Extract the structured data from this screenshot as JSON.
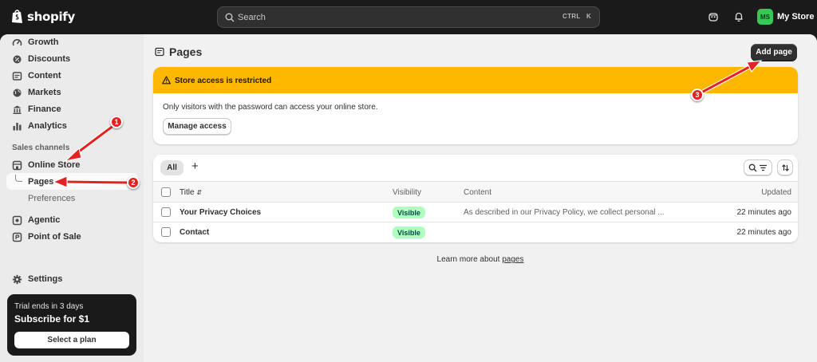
{
  "topbar": {
    "logo": "shopify",
    "search_placeholder": "Search",
    "shortcut_ctrl": "CTRL",
    "shortcut_key": "K",
    "store_initials": "MS",
    "store_name": "My Store"
  },
  "sidebar": {
    "items": [
      {
        "label": "Growth",
        "icon": "growth-icon"
      },
      {
        "label": "Discounts",
        "icon": "discount-icon"
      },
      {
        "label": "Content",
        "icon": "content-icon"
      },
      {
        "label": "Markets",
        "icon": "globe-icon"
      },
      {
        "label": "Finance",
        "icon": "bank-icon"
      },
      {
        "label": "Analytics",
        "icon": "chart-icon"
      }
    ],
    "section_label": "Sales channels",
    "online_store": "Online Store",
    "pages": "Pages",
    "preferences": "Preferences",
    "agentic": "Agentic",
    "point_of_sale": "Point of Sale",
    "settings": "Settings",
    "trial": {
      "line1": "Trial ends in 3 days",
      "line2": "Subscribe for $1",
      "button": "Select a plan"
    }
  },
  "main": {
    "title": "Pages",
    "add_button": "Add page",
    "banner": {
      "title": "Store access is restricted",
      "text": "Only visitors with the password can access your online store.",
      "button": "Manage access"
    },
    "tabs": {
      "all": "All",
      "add": "+"
    },
    "table": {
      "headers": {
        "title": "Title",
        "visibility": "Visibility",
        "content": "Content",
        "updated": "Updated"
      },
      "rows": [
        {
          "title": "Your Privacy Choices",
          "visibility": "Visible",
          "content": "As described in our Privacy Policy, we collect personal ...",
          "updated": "22 minutes ago"
        },
        {
          "title": "Contact",
          "visibility": "Visible",
          "content": "",
          "updated": "22 minutes ago"
        }
      ]
    },
    "learn_prefix": "Learn more about ",
    "learn_link": "pages"
  },
  "annotations": {
    "step1": "1",
    "step2": "2",
    "step3": "3"
  },
  "colors": {
    "accent": "#ffb800",
    "annotation": "#e32322",
    "badge_bg": "#affebf",
    "store_badge": "#36c756"
  }
}
